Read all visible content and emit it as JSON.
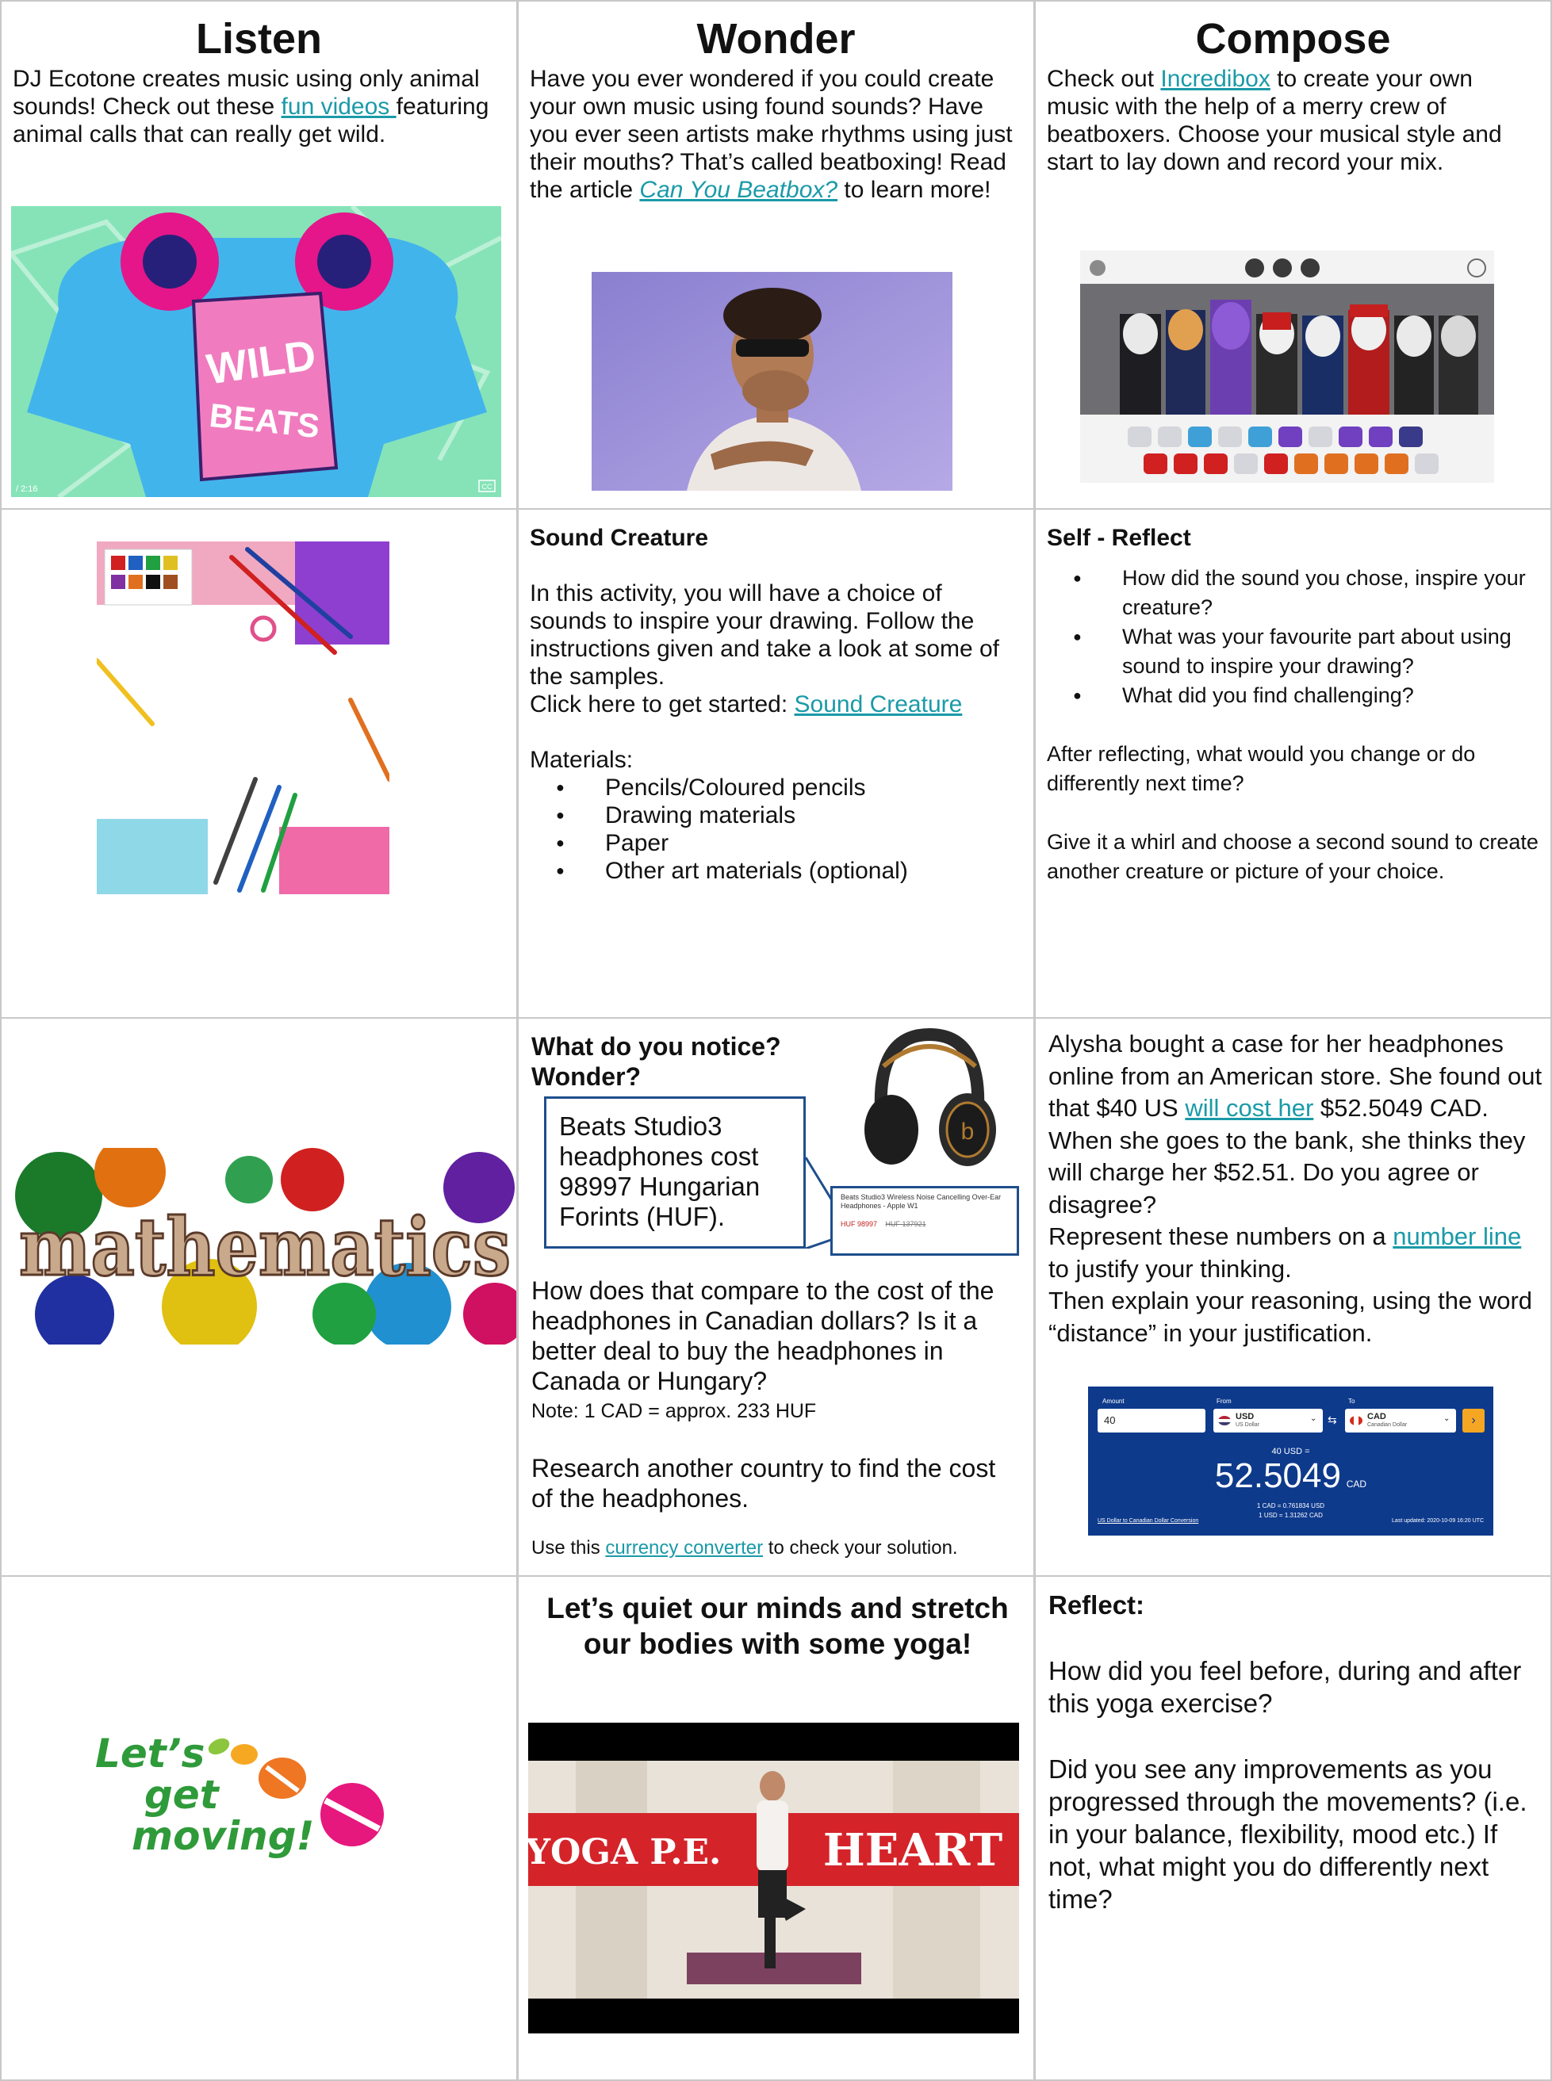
{
  "listen": {
    "heading": "Listen",
    "text_before_link": "DJ Ecotone creates music using only animal sounds! Check out these ",
    "link": "fun videos ",
    "text_after_link": "featuring animal calls that can really get wild.",
    "video": {
      "logo_line1": "WILD",
      "logo_line2": "BEATS",
      "time": "/ 2:16",
      "cc": "CC"
    }
  },
  "wonder": {
    "heading": "Wonder",
    "text_before_link": "Have you ever wondered if you could create your own music using found sounds? Have you ever seen artists make rhythms using just their mouths? That’s called beatboxing! Read the article ",
    "link": "Can You Beatbox?",
    "text_after_link": " to learn more!"
  },
  "compose": {
    "heading": "Compose",
    "text_before_link": "Check out ",
    "link": "Incredibox",
    "text_after_link": " to create your own music with the help of a merry crew of beatboxers. Choose your musical style and start to lay down and record your mix."
  },
  "sound_creature": {
    "title": "Sound Creature",
    "paragraph": "In this activity, you will have a choice of sounds to inspire your drawing. Follow the instructions given and take a look at some of the samples.",
    "click_text": "Click here to get started: ",
    "link": "Sound Creature",
    "materials_label": "Materials:",
    "materials": [
      "Pencils/Coloured pencils",
      "Drawing materials",
      "Paper",
      "Other art materials (optional)"
    ]
  },
  "self_reflect": {
    "title": "Self - Reflect",
    "questions": [
      "How did the sound you chose, inspire your creature?",
      "What was your favourite part about using sound to inspire your drawing?",
      "What did you find challenging?"
    ],
    "paragraph1": "After reflecting, what would you change or do differently next time?",
    "paragraph2": "Give it a whirl and choose a second sound to create another creature or picture of your choice."
  },
  "math": {
    "image_word": "mathematics",
    "notice_title": "What do you notice? Wonder?",
    "callout": "Beats Studio3 headphones cost 98997 Hungarian Forints (HUF).",
    "product_title": "Beats Studio3 Wireless Noise Cancelling Over-Ear Headphones - Apple W1",
    "product_price": "HUF 98997",
    "product_old_price": "HUF 137921",
    "question": "How does that compare to the cost of the headphones in Canadian dollars? Is it a better deal to buy the headphones in Canada or Hungary?",
    "note": "Note: 1 CAD = approx. 233 HUF",
    "research": "Research another country to find the cost of the headphones.",
    "checker_text": "Use this ",
    "checker_link": "currency converter",
    "checker_after": " to check your solution."
  },
  "alysha": {
    "p1_before": "Alysha bought a case for her headphones online from an American store. She found out that $40 US ",
    "p1_link": "will cost her",
    "p1_after": " $52.5049 CAD.",
    "p2": "When she goes to the bank, she thinks they will charge her $52.51. Do you agree or disagree?",
    "p3_before": "Represent these numbers on a ",
    "p3_link": "number line",
    "p3_after": " to justify your thinking.",
    "p4": "Then explain your reasoning, using the word “distance” in your justification.",
    "converter": {
      "amount_label": "Amount",
      "amount": "40",
      "from_label": "From",
      "from_code": "USD",
      "from_name": "US Dollar",
      "to_label": "To",
      "to_code": "CAD",
      "to_name": "Canadian Dollar",
      "equation": "40 USD =",
      "result": "52.5049",
      "result_unit": "CAD",
      "rate1": "1 CAD = 0.761834 USD",
      "rate2": "1 USD = 1.31262 CAD",
      "footer_left": "US Dollar to Canadian Dollar Conversion",
      "footer_right": "Last updated: 2020-10-09 16:20 UTC"
    }
  },
  "move": {
    "logo_line1": "Let’s",
    "logo_line2": "get",
    "logo_line3": "moving!",
    "yoga_title": "Let’s quiet our minds and stretch our bodies with some yoga!",
    "video_left": "YOGA P.E.",
    "video_right": "HEART"
  },
  "reflect": {
    "title": "Reflect:",
    "p1": "How did you feel before, during and after this yoga exercise?",
    "p2": "Did you see any improvements as you progressed through the movements? (i.e. in your balance, flexibility, mood etc.) If not, what might you do differently next time?"
  },
  "colors": {
    "link": "#1a9aa8",
    "border": "#c8c8c8",
    "callout": "#1f4e8c"
  }
}
